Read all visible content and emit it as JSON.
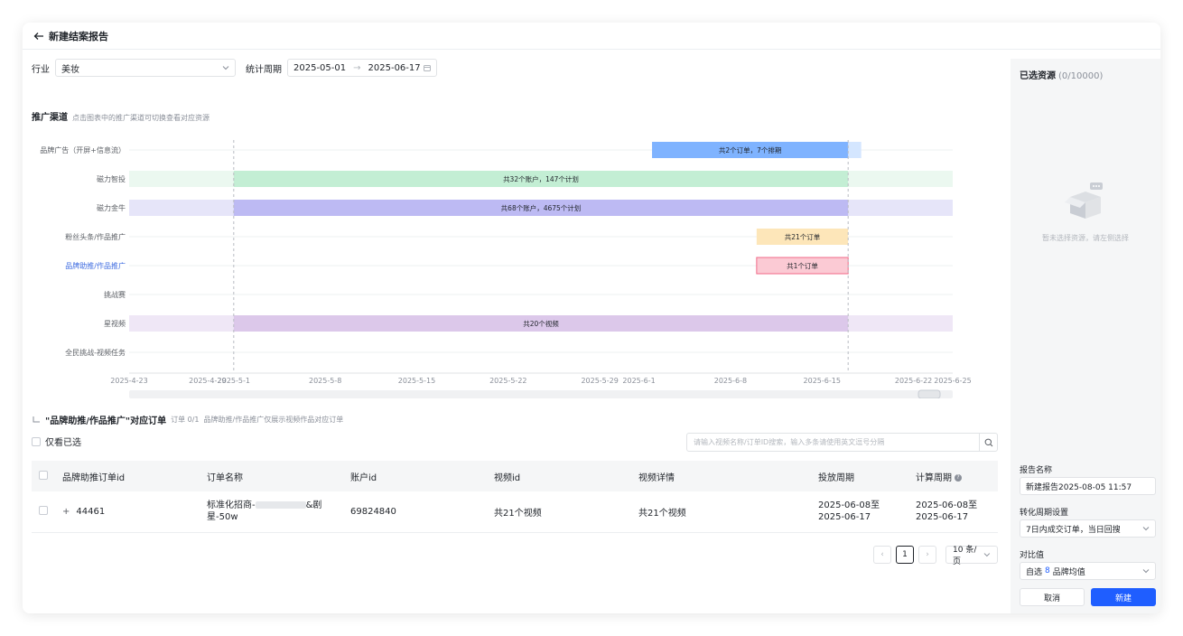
{
  "header": {
    "title": "新建结案报告"
  },
  "filters": {
    "industry_label": "行业",
    "industry_value": "美妆",
    "period_label": "统计周期",
    "date_start": "2025-05-01",
    "date_end": "2025-06-17"
  },
  "channels": {
    "title": "推广渠道",
    "hint": "点击图表中的推广渠道可切换查看对应资源"
  },
  "chart_data": {
    "type": "gantt",
    "ylabels": [
      "品牌广告（开屏+信息流）",
      "磁力智投",
      "磁力金牛",
      "粉丝头条/作品推广",
      "品牌助推/作品推广",
      "挑战赛",
      "星视频",
      "全民挑战-视频任务"
    ],
    "active_index": 4,
    "xticks": [
      "2025-4-23",
      "2025-4-29",
      "2025-5-1",
      "2025-5-8",
      "2025-5-15",
      "2025-5-22",
      "2025-5-29",
      "2025-6-1",
      "2025-6-8",
      "2025-6-15",
      "2025-6-22",
      "2025-6-25"
    ],
    "x_range": [
      "2025-04-23",
      "2025-06-25"
    ],
    "period_marker": [
      "2025-05-01",
      "2025-06-17"
    ],
    "bars": [
      {
        "row": 0,
        "start": "2025-06-02",
        "end": "2025-06-17",
        "label": "共2个订单，7个排期",
        "color": "#7fb3ff",
        "ext_start": "2025-06-17",
        "ext_end": "2025-06-18",
        "ext_color": "#d4e6ff"
      },
      {
        "row": 1,
        "start": "2025-05-01",
        "end": "2025-06-17",
        "label": "共32个账户，147个计划",
        "color": "#c3eed4",
        "ext_start": "2025-04-23",
        "ext_end": "2025-06-25",
        "ext_color": "#ebf8f0"
      },
      {
        "row": 2,
        "start": "2025-05-01",
        "end": "2025-06-17",
        "label": "共68个账户，4675个计划",
        "color": "#bdbaf3",
        "ext_start": "2025-04-23",
        "ext_end": "2025-06-25",
        "ext_color": "#e6e5f9"
      },
      {
        "row": 3,
        "start": "2025-06-10",
        "end": "2025-06-17",
        "label": "共21个订单",
        "color": "#fde6b9",
        "ext_start": "2025-06-17",
        "ext_end": "2025-06-17",
        "ext_color": "#fdf1d9"
      },
      {
        "row": 4,
        "start": "2025-06-10",
        "end": "2025-06-17",
        "label": "共1个订单",
        "color": "#fbcad4",
        "ext_start": "2025-06-17",
        "ext_end": "2025-06-17",
        "ext_color": "#fde3e8",
        "outline": "#f06a88"
      },
      {
        "row": 6,
        "start": "2025-05-01",
        "end": "2025-06-17",
        "label": "共20个视频",
        "color": "#dcc8ea",
        "ext_start": "2025-04-23",
        "ext_end": "2025-06-25",
        "ext_color": "#efe7f6"
      }
    ]
  },
  "orders": {
    "title": "\"品牌助推/作品推广\"对应订单",
    "count": "订单 0/1",
    "note": "品牌助推/作品推广仅展示视频作品对应订单",
    "only_selected": "仅看已选",
    "search_placeholder": "请输入视频名称/订单ID搜索，输入多条请使用英文逗号分隔",
    "columns": [
      "品牌助推订单id",
      "订单名称",
      "账户id",
      "视频id",
      "视频详情",
      "投放周期",
      "计算周期"
    ],
    "rows": [
      {
        "id": "44461",
        "name_line1": "标准化招商-",
        "name_end": "&剧",
        "name_line2": "星-50w",
        "account_id": "69824840",
        "video_id": "共21个视频",
        "video_detail": "共21个视频",
        "delivery_start": "2025-06-08至",
        "delivery_end": "2025-06-17",
        "calc_start": "2025-06-08至",
        "calc_end": "2025-06-17"
      }
    ],
    "pagination": {
      "prev": "‹",
      "page": "1",
      "next": "›",
      "page_size": "10 条/页"
    }
  },
  "sidebar": {
    "title": "已选资源",
    "count": "(0/10000)",
    "empty_text": "暂未选择资源，请左侧选择",
    "report_name_label": "报告名称",
    "report_name_value": "新建报告2025-08-05 11:57",
    "conversion_label": "转化周期设置",
    "conversion_value": "7日内成交订单，当日回搜",
    "compare_label": "对比值",
    "compare_prefix": "自选",
    "compare_count": "8",
    "compare_suffix": "品牌均值",
    "cancel": "取消",
    "create": "新建"
  },
  "colors": {
    "accent": "#1f5eff",
    "active_label": "#3d6be0"
  }
}
